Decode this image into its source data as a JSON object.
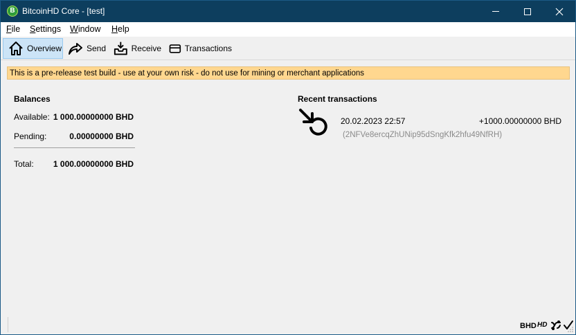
{
  "window": {
    "title": "BitcoinHD Core - [test]",
    "app_icon_letter": "B"
  },
  "menu": {
    "items": [
      {
        "mnemonic": "F",
        "rest": "ile"
      },
      {
        "mnemonic": "S",
        "rest": "ettings"
      },
      {
        "mnemonic": "W",
        "rest": "indow"
      },
      {
        "mnemonic": "H",
        "rest": "elp"
      }
    ]
  },
  "toolbar": {
    "overview_label": "Overview",
    "send_label": "Send",
    "receive_label": "Receive",
    "transactions_label": "Transactions",
    "active_tab": "Overview"
  },
  "warning": {
    "text": "This is a pre-release test build - use at your own risk - do not use for mining or merchant applications"
  },
  "balances": {
    "title": "Balances",
    "available_label": "Available:",
    "available_value": "1 000.00000000 BHD",
    "pending_label": "Pending:",
    "pending_value": "0.00000000 BHD",
    "total_label": "Total:",
    "total_value": "1 000.00000000 BHD"
  },
  "recent": {
    "title": "Recent transactions",
    "transactions": [
      {
        "date": "20.02.2023 22:57",
        "amount": "+1000.00000000 BHD",
        "address": "(2NFVe8ercqZhUNip95dSngKfk2hfu49NfRH)",
        "icon": "receive-arrow-icon"
      }
    ]
  },
  "statusbar": {
    "unit": "BHD",
    "hd_label": "HD",
    "icons": [
      "network-icon",
      "synced-check-icon"
    ]
  },
  "colors": {
    "titlebar": "#0d3e5e",
    "warning_bg": "#ffd78f",
    "active_tab_bg": "#cce4f7"
  }
}
